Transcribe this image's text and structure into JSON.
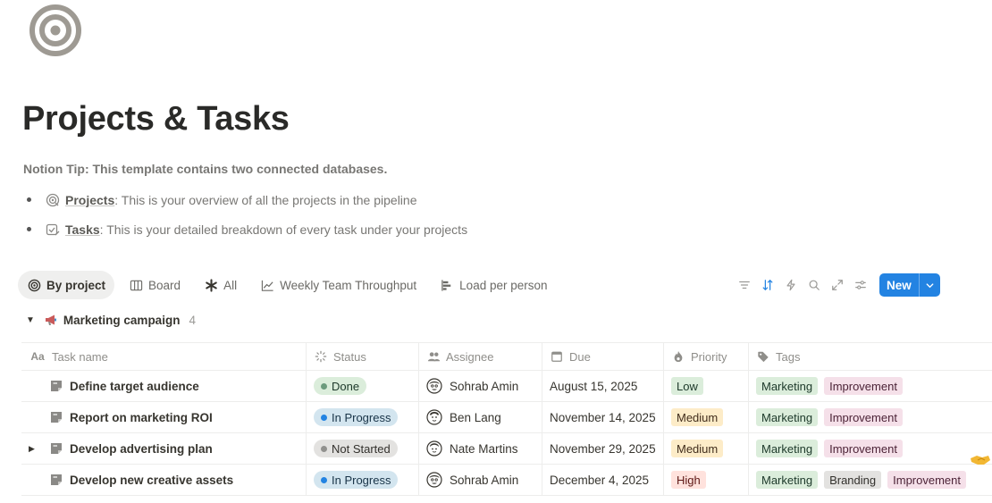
{
  "page": {
    "icon": "target-icon",
    "title": "Projects & Tasks",
    "tip": "Notion Tip: This template contains two connected databases.",
    "bullets": [
      {
        "icon": "target-small-icon",
        "link": "Projects",
        "text": ": This is your overview of all the projects in the pipeline"
      },
      {
        "icon": "checkbox-edit-icon",
        "link": "Tasks",
        "text": ": This is your detailed breakdown of every task under your projects"
      }
    ]
  },
  "views": [
    {
      "label": "By project",
      "icon": "target-icon",
      "active": true
    },
    {
      "label": "Board",
      "icon": "board-icon"
    },
    {
      "label": "All",
      "icon": "asterisk-icon"
    },
    {
      "label": "Weekly Team Throughput",
      "icon": "line-chart-icon"
    },
    {
      "label": "Load per person",
      "icon": "bar-chart-icon"
    }
  ],
  "toolbar": {
    "new_label": "New",
    "tools": [
      "filter-icon",
      "sort-icon",
      "automation-icon",
      "search-icon",
      "expand-icon",
      "settings-icon"
    ]
  },
  "group": {
    "name": "Marketing campaign",
    "count": "4"
  },
  "columns": {
    "name": "Task name",
    "status": "Status",
    "assignee": "Assignee",
    "due": "Due",
    "priority": "Priority",
    "tags": "Tags"
  },
  "rows": [
    {
      "name": "Define target audience",
      "status": "Done",
      "assignee": "Sohrab Amin",
      "due": "August 15, 2025",
      "priority": "Low",
      "tags": [
        "Marketing",
        "Improvement"
      ]
    },
    {
      "name": "Report on marketing ROI",
      "status": "In Progress",
      "assignee": "Ben Lang",
      "due": "November 14, 2025",
      "priority": "Medium",
      "tags": [
        "Marketing",
        "Improvement"
      ]
    },
    {
      "name": "Develop advertising plan",
      "status": "Not Started",
      "assignee": "Nate Martins",
      "due": "November 29, 2025",
      "priority": "Medium",
      "tags": [
        "Marketing",
        "Improvement"
      ]
    },
    {
      "name": "Develop new creative assets",
      "status": "In Progress",
      "assignee": "Sohrab Amin",
      "due": "December 4, 2025",
      "priority": "High",
      "tags": [
        "Marketing",
        "Branding",
        "Improvement"
      ]
    }
  ],
  "colors": {
    "accent": "#2383e2",
    "status_done_bg": "#dbeddb",
    "status_done_dot": "#6c9b7d",
    "status_progress_bg": "#d3e5ef",
    "status_progress_dot": "#5b97bd",
    "status_notstarted_bg": "#e3e2e0",
    "status_notstarted_dot": "#91918e",
    "priority_low_bg": "#dbeddb",
    "priority_medium_bg": "#fdecc8",
    "priority_high_bg": "#ffe2dd",
    "tag_marketing_bg": "#dbeddb",
    "tag_improvement_bg": "#f5e0e9",
    "tag_branding_bg": "#e3e2e0"
  }
}
